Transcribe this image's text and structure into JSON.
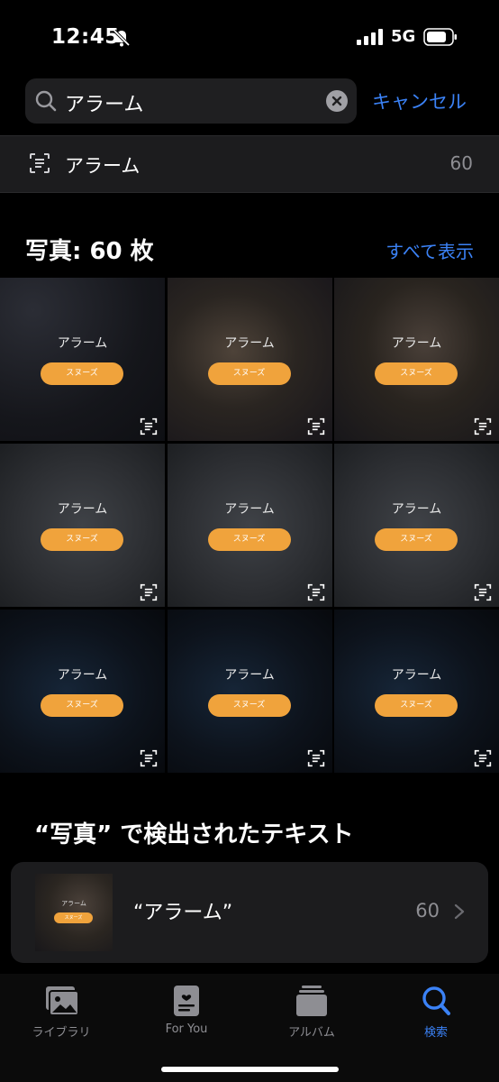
{
  "status_bar": {
    "time": "12:45",
    "network": "5G"
  },
  "search": {
    "query": "アラーム",
    "cancel_label": "キャンセル"
  },
  "suggestion": {
    "label": "アラーム",
    "count": "60"
  },
  "photos": {
    "title": "写真: 60 枚",
    "see_all": "すべて表示",
    "items": [
      {
        "label": "アラーム",
        "button": "スヌーズ"
      },
      {
        "label": "アラーム",
        "button": "スヌーズ"
      },
      {
        "label": "アラーム",
        "button": "スヌーズ"
      },
      {
        "label": "アラーム",
        "button": "スヌーズ"
      },
      {
        "label": "アラーム",
        "button": "スヌーズ"
      },
      {
        "label": "アラーム",
        "button": "スヌーズ"
      },
      {
        "label": "アラーム",
        "button": "スヌーズ"
      },
      {
        "label": "アラーム",
        "button": "スヌーズ"
      },
      {
        "label": "アラーム",
        "button": "スヌーズ"
      }
    ]
  },
  "detected": {
    "title": "“写真” で検出されたテキスト",
    "text": "“アラーム”",
    "count": "60",
    "thumb_label": "アラーム",
    "thumb_button": "スヌーズ"
  },
  "tabs": [
    {
      "label": "ライブラリ",
      "icon": "photo-library-icon",
      "active": false
    },
    {
      "label": "For You",
      "icon": "for-you-icon",
      "active": false
    },
    {
      "label": "アルバム",
      "icon": "albums-icon",
      "active": false
    },
    {
      "label": "検索",
      "icon": "search-icon",
      "active": true
    }
  ],
  "colors": {
    "accent": "#3b82f6",
    "snooze": "#f0a33c",
    "background": "#000000",
    "card": "#1c1c1e"
  }
}
